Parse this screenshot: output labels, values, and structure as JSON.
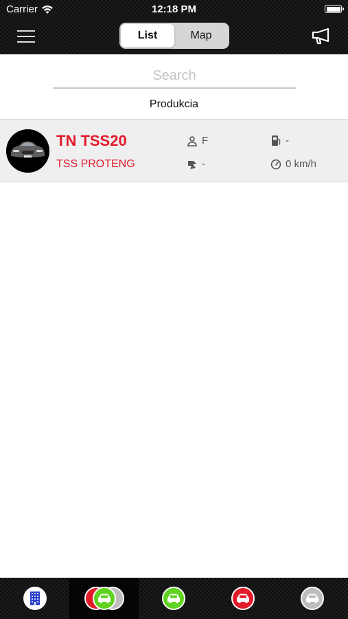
{
  "status_bar": {
    "carrier": "Carrier",
    "time": "12:18 PM"
  },
  "header": {
    "segments": [
      {
        "label": "List",
        "selected": true
      },
      {
        "label": "Map",
        "selected": false
      }
    ]
  },
  "search": {
    "placeholder": "Search",
    "value": ""
  },
  "group": {
    "label": "Produkcia"
  },
  "vehicles": [
    {
      "plate": "TN TSS20",
      "company": "TSS PROTENG",
      "driver": "F",
      "fuel": "-",
      "engine": "-",
      "speed": "0 km/h"
    }
  ],
  "bottom_tabs": [
    {
      "name": "buildings",
      "icon": "building-icon",
      "color": "#2b3fc9"
    },
    {
      "name": "all-vehicles",
      "icon": "car-stack-icon",
      "colors": [
        "#e21b2a",
        "#5fd31f",
        "#bdbdbd"
      ]
    },
    {
      "name": "moving",
      "icon": "car-icon",
      "color": "#5fd31f"
    },
    {
      "name": "stopped",
      "icon": "car-icon",
      "color": "#e21b2a"
    },
    {
      "name": "offline",
      "icon": "car-icon",
      "color": "#bdbdbd"
    }
  ],
  "colors": {
    "accent": "#e21b2a",
    "header_bg": "#111111"
  }
}
